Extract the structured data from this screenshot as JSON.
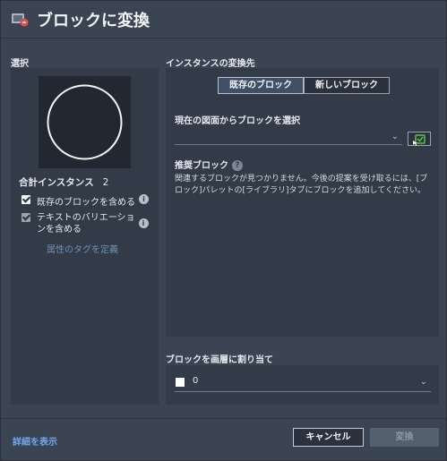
{
  "window": {
    "title": "ブロックに変換",
    "icon": "block-convert-icon"
  },
  "left": {
    "section_label": "選択",
    "total_instances_label": "合計インスタンス",
    "total_instances_value": "2",
    "include_existing_block": {
      "label": "既存のブロックを含める",
      "checked": true
    },
    "include_text_variations": {
      "label_line1": "テキストのバリエーショ",
      "label_line2": "ンを含める",
      "checked": true,
      "disabled": true
    },
    "define_attribute_tags": "属性のタグを定義"
  },
  "right": {
    "section_label": "インスタンスの変換先",
    "tabs": [
      {
        "label": "既存のブロック",
        "active": true
      },
      {
        "label": "新しいブロック",
        "active": false
      }
    ],
    "select_from_drawing_label": "現在の図面からブロックを選択",
    "select_value": "",
    "recommended_label": "推奨ブロック",
    "recommended_desc": "関連するブロックが見つかりません。今後の提案を受け取るには、[ブロック]パレットの[ライブラリ]タブにブロックを追加してください。"
  },
  "layer": {
    "section_label": "ブロックを画層に割り当て",
    "value": "0",
    "swatch_color": "#ffffff"
  },
  "footer": {
    "details_link": "詳細を表示",
    "cancel_label": "キャンセル",
    "convert_label": "変換"
  }
}
